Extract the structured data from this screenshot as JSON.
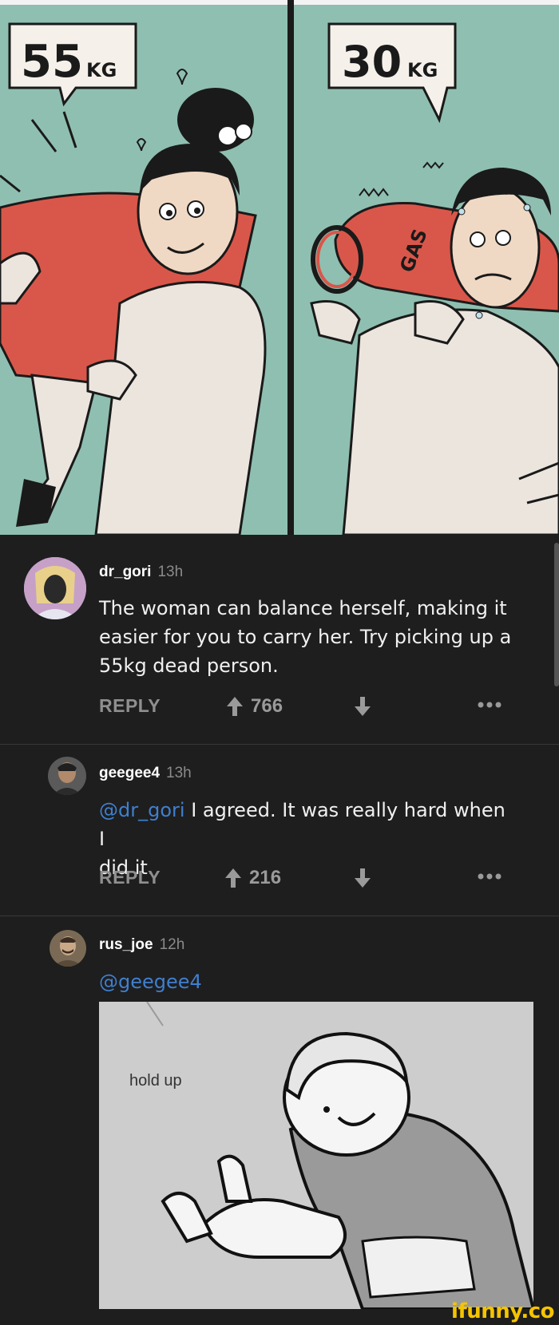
{
  "comic": {
    "left_weight": "55",
    "left_unit": "KG",
    "right_weight": "30",
    "right_unit": "KG",
    "tank_label": "GAS"
  },
  "comments": [
    {
      "username": "dr_gori",
      "time": "13h",
      "text_lines": [
        "The woman can balance herself, making it",
        "easier for you to carry her. Try picking up a",
        "55kg dead person."
      ],
      "reply_label": "REPLY",
      "upvotes": "766"
    },
    {
      "username": "geegee4",
      "time": "13h",
      "mention": "@dr_gori",
      "text_line1_rest": " I agreed. It was really hard when I",
      "text_line2": "did it.",
      "reply_label": "REPLY",
      "upvotes": "216"
    },
    {
      "username": "rus_joe",
      "time": "12h",
      "mention": "@geegee4",
      "meme_caption": "hold up"
    }
  ],
  "watermark": "ifunny.co",
  "colors": {
    "background": "#1e1e1e",
    "mention": "#3f7fd0",
    "watermark": "#f5c400",
    "comic_bg": "#8fbfb0"
  }
}
